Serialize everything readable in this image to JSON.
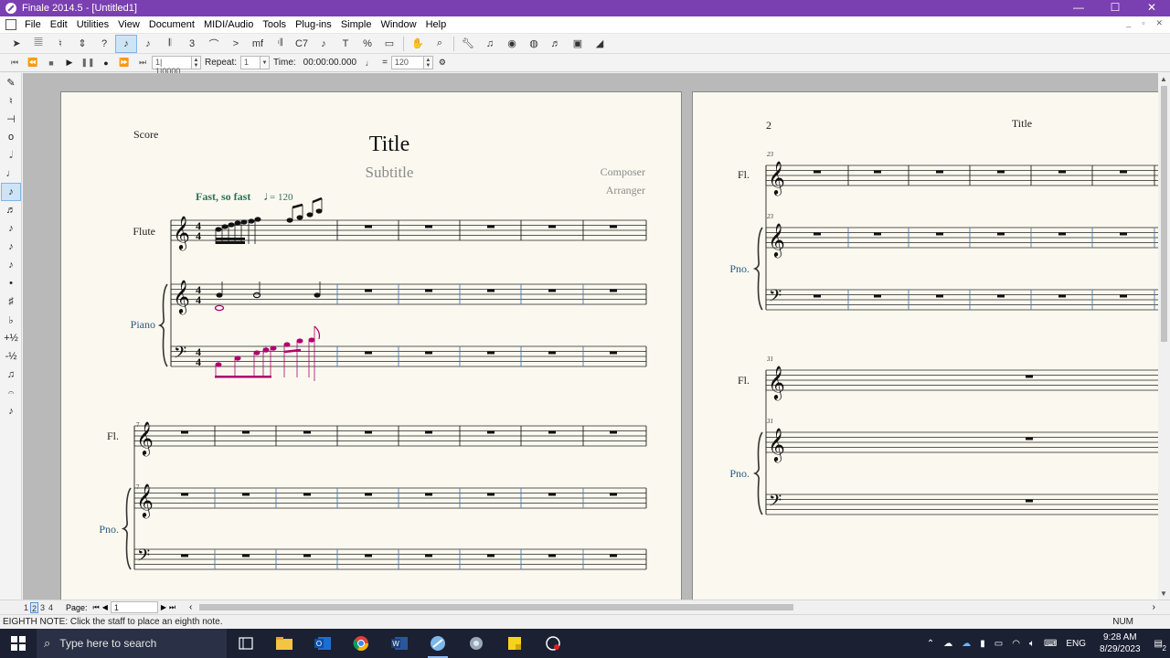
{
  "window": {
    "title": "Finale 2014.5 - [Untitled1]",
    "minimize": "—",
    "maximize": "☐",
    "close": "✕"
  },
  "menu": [
    "File",
    "Edit",
    "Utilities",
    "View",
    "Document",
    "MIDI/Audio",
    "Tools",
    "Plug-ins",
    "Simple",
    "Window",
    "Help"
  ],
  "toolbar": {
    "tools": [
      "selection-tool",
      "staff-tool",
      "simple-entry-tool",
      "speedy-entry-tool",
      "hyperscribe-tool",
      "smart-shape-tool",
      "eighth-note-tool",
      "quarter-note-tool",
      "measure-tool",
      "tuplet-tool",
      "slur-tool",
      "articulation-tool",
      "expression-tool",
      "repeat-tool",
      "chord-tool",
      "lyrics-tool",
      "text-tool",
      "resize-tool",
      "page-layout-tool",
      "hand-grabber-tool",
      "zoom-tool",
      "wrench-tool",
      "midi-tool",
      "special-tools",
      "mirror-tool",
      "note-mover-tool",
      "graphics-tool",
      "ossia-tool"
    ],
    "active_index": 6
  },
  "playback": {
    "position": "1| 1|0000",
    "repeat_label": "Repeat:",
    "repeat_value": "1",
    "time_label": "Time:",
    "time_value": "00:00:00.000",
    "tempo_eq": "=",
    "tempo_value": "120"
  },
  "palette": {
    "items": [
      "pencil-icon",
      "tie-icon",
      "rest-icon",
      "whole-note-icon",
      "half-note-icon",
      "quarter-note-icon",
      "eighth-note-icon",
      "sixteenth-note-icon",
      "thirty-second-note-icon",
      "sixty-fourth-note-icon",
      "hundred-twenty-eighth-note-icon",
      "dot-icon",
      "sharp-icon",
      "flat-icon",
      "half-step-up-icon",
      "half-step-down-icon",
      "tuplet-icon",
      "grace-note-icon",
      "cue-note-icon"
    ],
    "labels": [
      "✎",
      "♮",
      "⊣",
      "o",
      "𝅗𝅥",
      "♩",
      "♪",
      "♬",
      "♪",
      "♪",
      "♪",
      "•",
      "♯",
      "♭",
      "+½",
      "-½",
      "♫",
      "𝄐",
      "♪"
    ],
    "active_index": 6
  },
  "page1": {
    "label": "Score",
    "title": "Title",
    "subtitle": "Subtitle",
    "composer": "Composer",
    "arranger": "Arranger",
    "tempo_marking": "Fast, so fast",
    "tempo_value": "= 120",
    "system1": {
      "flute": "Flute",
      "piano": "Piano"
    },
    "system2": {
      "measure_number": "7",
      "flute": "Fl.",
      "piano": "Pno.",
      "piano_measure_number": "7"
    }
  },
  "page2": {
    "page_number": "2",
    "title": "Title",
    "system1": {
      "measure_number": "23",
      "flute": "Fl.",
      "piano": "Pno.",
      "piano_measure_number": "23"
    },
    "system2": {
      "measure_number": "31",
      "flute": "Fl.",
      "piano": "Pno.",
      "piano_measure_number": "31"
    }
  },
  "pagebar": {
    "page_tabs": [
      "1",
      "2",
      "3",
      "4"
    ],
    "active_tab": 1,
    "page_label": "Page:",
    "page_value": "1"
  },
  "status": {
    "message": "EIGHTH NOTE: Click the staff to place an eighth note.",
    "num": "NUM"
  },
  "taskbar": {
    "search_placeholder": "Type here to search",
    "apps": [
      "task-view-icon",
      "file-explorer-icon",
      "outlook-icon",
      "chrome-icon",
      "word-icon",
      "finale-icon",
      "app-icon",
      "sticky-notes-icon",
      "recorder-icon"
    ],
    "active_app": "finale-icon",
    "language": "ENG",
    "time": "9:28 AM",
    "date": "8/29/2023",
    "notification_count": "2"
  },
  "colors": {
    "title_bar": "#7a3fb0",
    "page_bg": "#fbf9ef",
    "instrument_label": "#2a5a80",
    "tempo_text": "#2f6f5a",
    "selected_notes": "#b0006e"
  }
}
